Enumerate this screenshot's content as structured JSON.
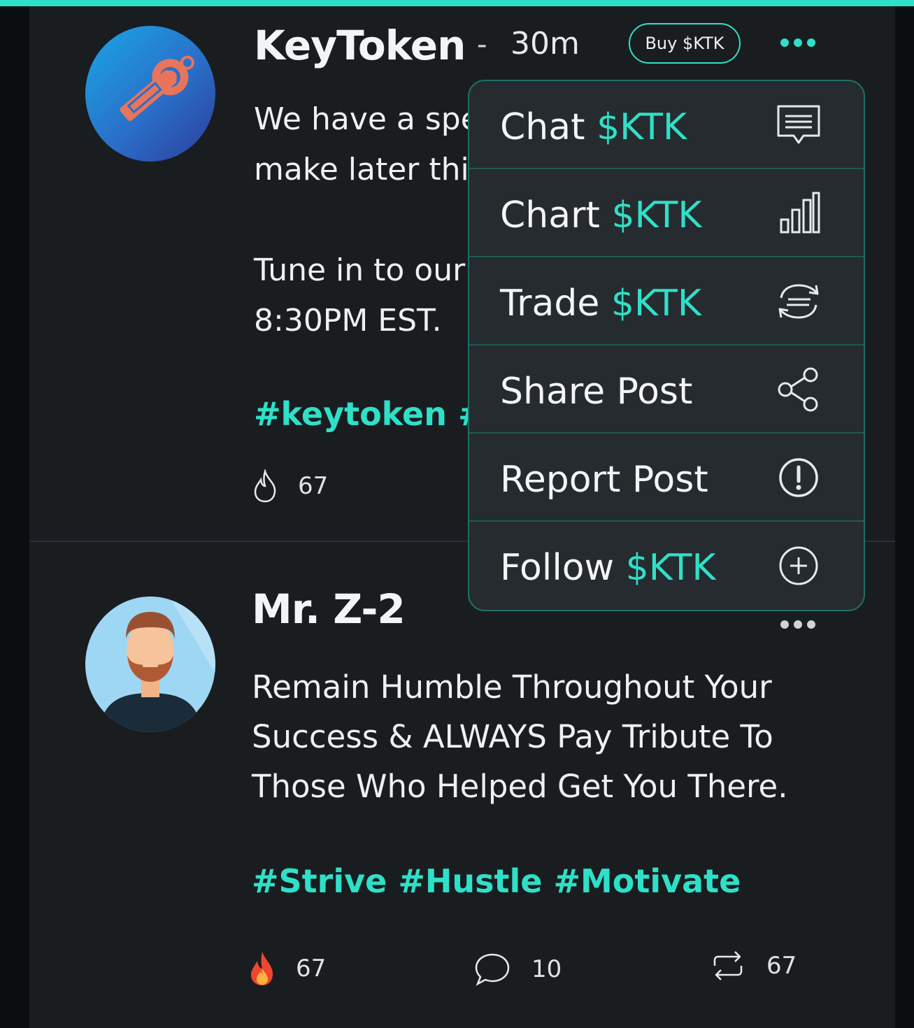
{
  "posts": [
    {
      "username": "KeyToken",
      "separator": "-",
      "time": "30m",
      "buy_label": "Buy $KTK",
      "text": [
        "We have a spe",
        "make later thi",
        "",
        "Tune in to our",
        "8:30PM EST."
      ],
      "hashtags": "#keytoken #c",
      "stats": {
        "fire": "67"
      }
    },
    {
      "username": "Mr. Z-2",
      "text": [
        "Remain Humble Throughout Your",
        "Success & ALWAYS Pay Tribute To",
        "Those Who Helped Get You There."
      ],
      "hashtags": "#Strive #Hustle #Motivate",
      "stats": {
        "fire": "67",
        "comments": "10",
        "reposts": "67"
      }
    }
  ],
  "menu": {
    "items": [
      {
        "label": "Chat",
        "token": "$KTK",
        "icon": "chat-icon"
      },
      {
        "label": "Chart",
        "token": "$KTK",
        "icon": "chart-icon"
      },
      {
        "label": "Trade",
        "token": "$KTK",
        "icon": "trade-icon"
      },
      {
        "label": "Share Post",
        "token": "",
        "icon": "share-icon"
      },
      {
        "label": "Report Post",
        "token": "",
        "icon": "report-icon"
      },
      {
        "label": "Follow",
        "token": "$KTK",
        "icon": "follow-plus-icon"
      }
    ]
  },
  "colors": {
    "accent": "#2fe0c8",
    "background": "#191d20",
    "menu": "#262b2f"
  }
}
